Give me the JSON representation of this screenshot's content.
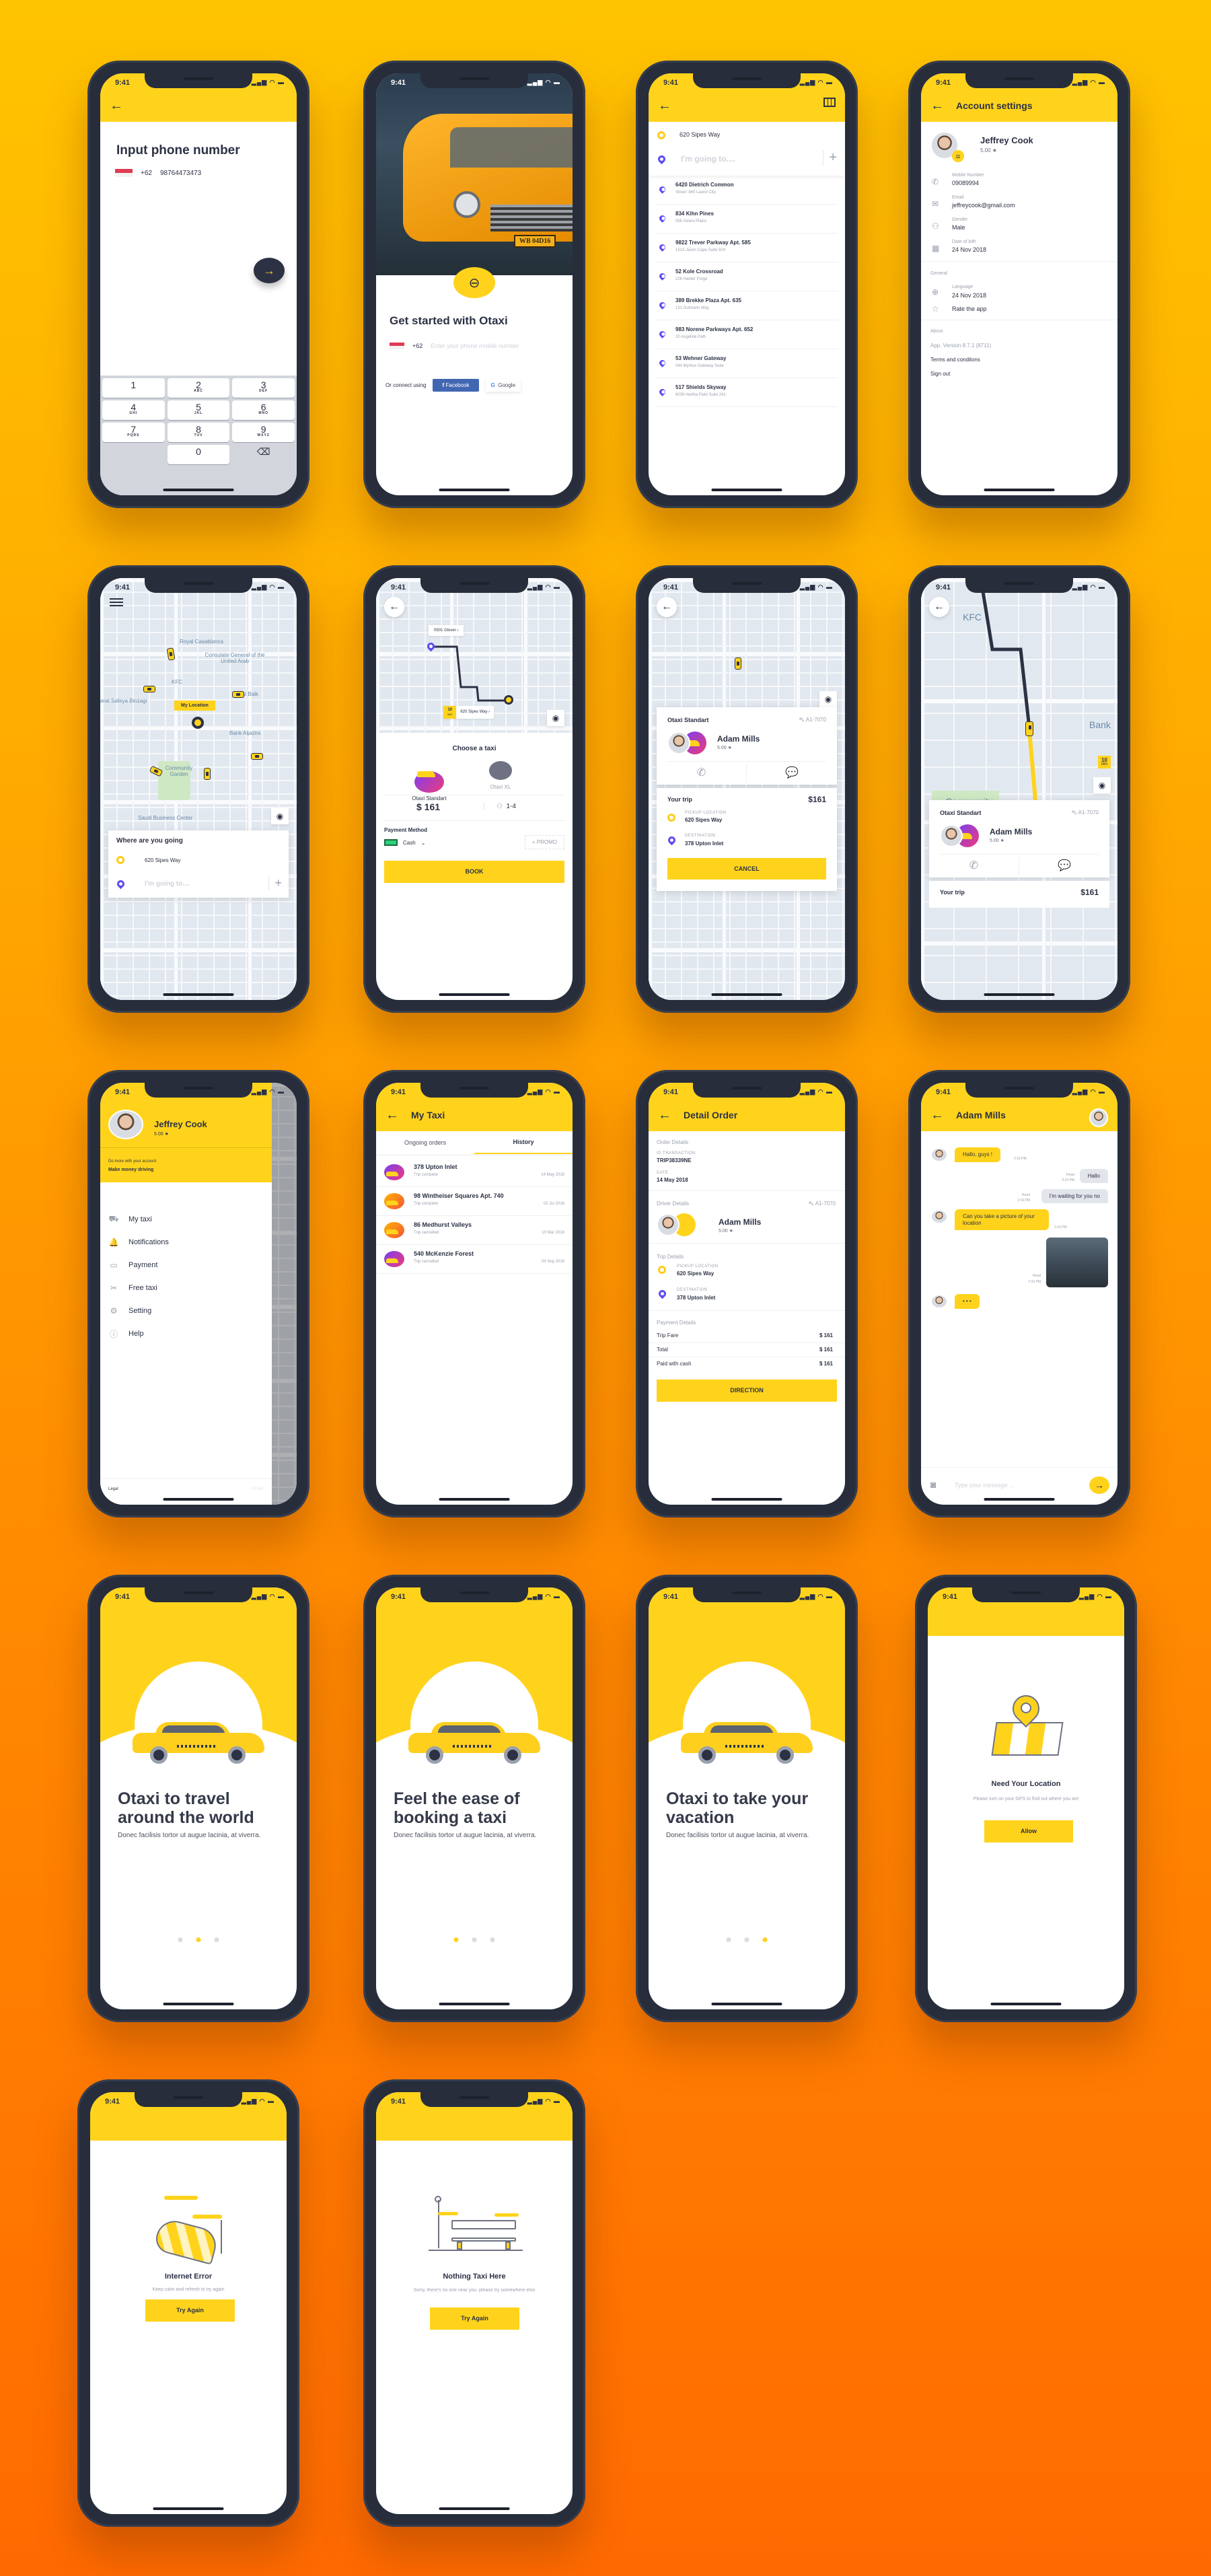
{
  "status_time": "9:41",
  "status_icons": "▂▄▆ ◠ ▬",
  "colors": {
    "brand_yellow": "#ffd31c",
    "accent_purple": "#5b4cf4",
    "dark": "#2c3144",
    "facebook": "#4267b2"
  },
  "phone_input": {
    "title": "Input phone number",
    "country_code": "+62",
    "phone_value": "98764473473",
    "keypad": [
      {
        "digit": "1",
        "letters": ""
      },
      {
        "digit": "2",
        "letters": "ABC"
      },
      {
        "digit": "3",
        "letters": "DEF"
      },
      {
        "digit": "4",
        "letters": "GHI"
      },
      {
        "digit": "5",
        "letters": "JKL"
      },
      {
        "digit": "6",
        "letters": "MNO"
      },
      {
        "digit": "7",
        "letters": "PQRS"
      },
      {
        "digit": "8",
        "letters": "TUV"
      },
      {
        "digit": "9",
        "letters": "WXYZ"
      },
      {
        "digit": "",
        "letters": ""
      },
      {
        "digit": "0",
        "letters": ""
      },
      {
        "digit": "⌫",
        "letters": ""
      }
    ]
  },
  "get_started": {
    "title": "Get started with Otaxi",
    "country_code": "+62",
    "phone_placeholder": "Enter your phone mobile number",
    "connect_label": "Or connect using",
    "facebook_label": "Facebook",
    "google_label": "Google",
    "plate": "WB 04D16"
  },
  "destination_search": {
    "pickup": "620 Sipes Way",
    "dest_placeholder": "I'm going to....",
    "places": [
      {
        "name": "6420 Dietrich Common",
        "detail": "Street: 840 Laurel City:"
      },
      {
        "name": "834 Kihn Pines",
        "detail": "055 Alvera Plains"
      },
      {
        "name": "9822 Trever Parkway Apt. 585",
        "detail": "1513 Jasen Cape Suite 924"
      },
      {
        "name": "52 Kole Crossroad",
        "detail": "226 Harber Forge"
      },
      {
        "name": "389 Brekke Plaza Apt. 635",
        "detail": "131 Gutmann Way"
      },
      {
        "name": "983 Norene Parkways Apt. 652",
        "detail": "20 Angeline Path"
      },
      {
        "name": "53 Wehner Gateway",
        "detail": "044 Myrtice Gateway Suite"
      },
      {
        "name": "517 Shields Skyway",
        "detail": "6039 Hertha Field Suite 241"
      }
    ]
  },
  "account_settings": {
    "title": "Account settings",
    "name": "Jeffrey Cook",
    "rating": "5.00 ★",
    "fields": [
      {
        "icon": "phone",
        "label": "Mobile Number",
        "value": "09089994"
      },
      {
        "icon": "mail",
        "label": "Email",
        "value": "jeffreycook@gmail.com"
      },
      {
        "icon": "user",
        "label": "Gender",
        "value": "Male"
      },
      {
        "icon": "calendar",
        "label": "Date of bith",
        "value": "24 Nov 2018"
      }
    ],
    "general_label": "General",
    "language_label": "Language",
    "language_value": "24 Nov 2018",
    "rate_app": "Rate the app",
    "about_label": "About",
    "version": "App. Version 8.7.1 (8711)",
    "terms": "Terms and conditons",
    "sign_out": "Sign out"
  },
  "home_map": {
    "labels": [
      "Royal Casablanca",
      "Consulate General of the United Arab",
      "KFC",
      "arat Safeya Binzagr",
      "Al Baik",
      "Bank Aljazira",
      "Community Garden",
      "Saudi Business Center"
    ],
    "my_location": "My Location",
    "panel_title": "Where are you going",
    "pickup": "620 Sipes Way",
    "dest_placeholder": "I'm going to...."
  },
  "choose_taxi": {
    "from_label": "0501 Glover",
    "eta_value": "10",
    "eta_unit": "MIN",
    "to_label": "620 Sipes Way",
    "title": "Choose a taxi",
    "options": [
      {
        "name": "Otaxi Standart",
        "selected": true
      },
      {
        "name": "Otaxi XL",
        "selected": false
      }
    ],
    "price": "$ 161",
    "seats": "1-4",
    "payment_label": "Payment Method",
    "payment_value": "Cash",
    "promo": "+ PROMO",
    "book": "BOOK"
  },
  "driver_found": {
    "service": "Otaxi Standart",
    "plate": "A1-7070",
    "driver": "Adam Mills",
    "rating": "5.00 ★",
    "trip_label": "Your trip",
    "trip_price": "$161",
    "pickup_label": "PICKUP LOCATION",
    "pickup": "620 Sipes Way",
    "dest_label": "DESTINATION",
    "dest": "378 Upton Inlet",
    "cancel": "CANCEL"
  },
  "tracking": {
    "eta_value": "10",
    "eta_unit": "MIN",
    "map_labels": [
      "KFC",
      "Bank",
      "Community"
    ],
    "service": "Otaxi Standart",
    "plate": "A1-7070",
    "driver": "Adam Mills",
    "rating": "5.00 ★",
    "trip_label": "Your trip",
    "trip_price": "$161"
  },
  "side_menu": {
    "name": "Jeffrey Cook",
    "rating": "5.00 ★",
    "promo_small": "Do more with your account",
    "promo_big": "Make money driving",
    "items": [
      {
        "icon": "taxi",
        "label": "My taxi"
      },
      {
        "icon": "bell",
        "label": "Notifications"
      },
      {
        "icon": "card",
        "label": "Payment"
      },
      {
        "icon": "ticket",
        "label": "Free taxi"
      },
      {
        "icon": "gear",
        "label": "Setting"
      },
      {
        "icon": "info",
        "label": "Help"
      }
    ],
    "legal": "Legal",
    "version": "v3.345"
  },
  "my_taxi": {
    "title": "My Taxi",
    "tabs": [
      {
        "label": "Ongoing orders",
        "active": false
      },
      {
        "label": "History",
        "active": true
      }
    ],
    "history": [
      {
        "address": "378 Upton Inlet",
        "status": "Trip complete",
        "date": "14 May 2018"
      },
      {
        "address": "98 Wintheiser Squares Apt. 740",
        "status": "Trip complete",
        "date": "02 Jul 2018"
      },
      {
        "address": "86 Medhurst Valleys",
        "status": "Trip cancelled",
        "date": "10 Mar 2018"
      },
      {
        "address": "540 McKenzie Forest",
        "status": "Trip cancelled",
        "date": "04 Sep 2018"
      }
    ]
  },
  "detail_order": {
    "title": "Detail Order",
    "order_section": "Order Details",
    "id_label": "ID TRANSACTION",
    "id_value": "TRIP38339NE",
    "date_label": "DATE",
    "date_value": "14 May 2018",
    "driver_section": "Driver Details",
    "plate": "A1-7070",
    "driver": "Adam Mills",
    "rating": "5.00 ★",
    "trip_section": "Trip Details",
    "pickup_label": "PICKUP LOCATION",
    "pickup": "620 Sipes Way",
    "dest_label": "DESTINATION",
    "dest": "378 Upton Inlet",
    "payment_section": "Payment Details",
    "payment_rows": [
      {
        "label": "Trip Fare",
        "value": "$ 161"
      },
      {
        "label": "Total",
        "value": "$ 161"
      },
      {
        "label": "Paid with cash",
        "value": "$ 161"
      }
    ],
    "direction": "DIRECTION"
  },
  "chat": {
    "title": "Adam Mills",
    "messages": [
      {
        "from": "driver",
        "text": "Hallo, guys !",
        "time": "2:16 PM"
      },
      {
        "from": "me",
        "text": "Hallo",
        "status": "Read",
        "time": "2:16 PM"
      },
      {
        "from": "me",
        "text": "I'm waiting for you no",
        "status": "Read",
        "time": "2:16 PM"
      },
      {
        "from": "driver",
        "text": "Can you take a picture of your location",
        "time": "2:16 PM"
      },
      {
        "from": "me",
        "type": "image",
        "status": "Read",
        "time": "2:16 PM"
      },
      {
        "from": "driver",
        "text": "• • •",
        "time": ""
      }
    ],
    "input_placeholder": "Type your message ..."
  },
  "onboarding": [
    {
      "title": "Otaxi to travel around the world",
      "text": "Donec facilisis tortor ut augue lacinia, at viverra.",
      "active_dot": 1
    },
    {
      "title": "Feel the ease of booking a taxi",
      "text": "Donec facilisis tortor ut augue lacinia, at viverra.",
      "active_dot": 0
    },
    {
      "title": "Otaxi to take your vacation",
      "text": "Donec facilisis tortor ut augue lacinia, at viverra.",
      "active_dot": 2
    }
  ],
  "need_location": {
    "title": "Need Your Location",
    "text": "Please turn on your GPS to find out where you are",
    "button": "Allow"
  },
  "internet_error": {
    "title": "Internet Error",
    "text": "Keep calm and refresh to try again",
    "button": "Try Again"
  },
  "no_taxi": {
    "title": "Nothing Taxi Here",
    "text": "Sorry, there's no one near you. please try somewhere else",
    "button": "Try Again"
  }
}
